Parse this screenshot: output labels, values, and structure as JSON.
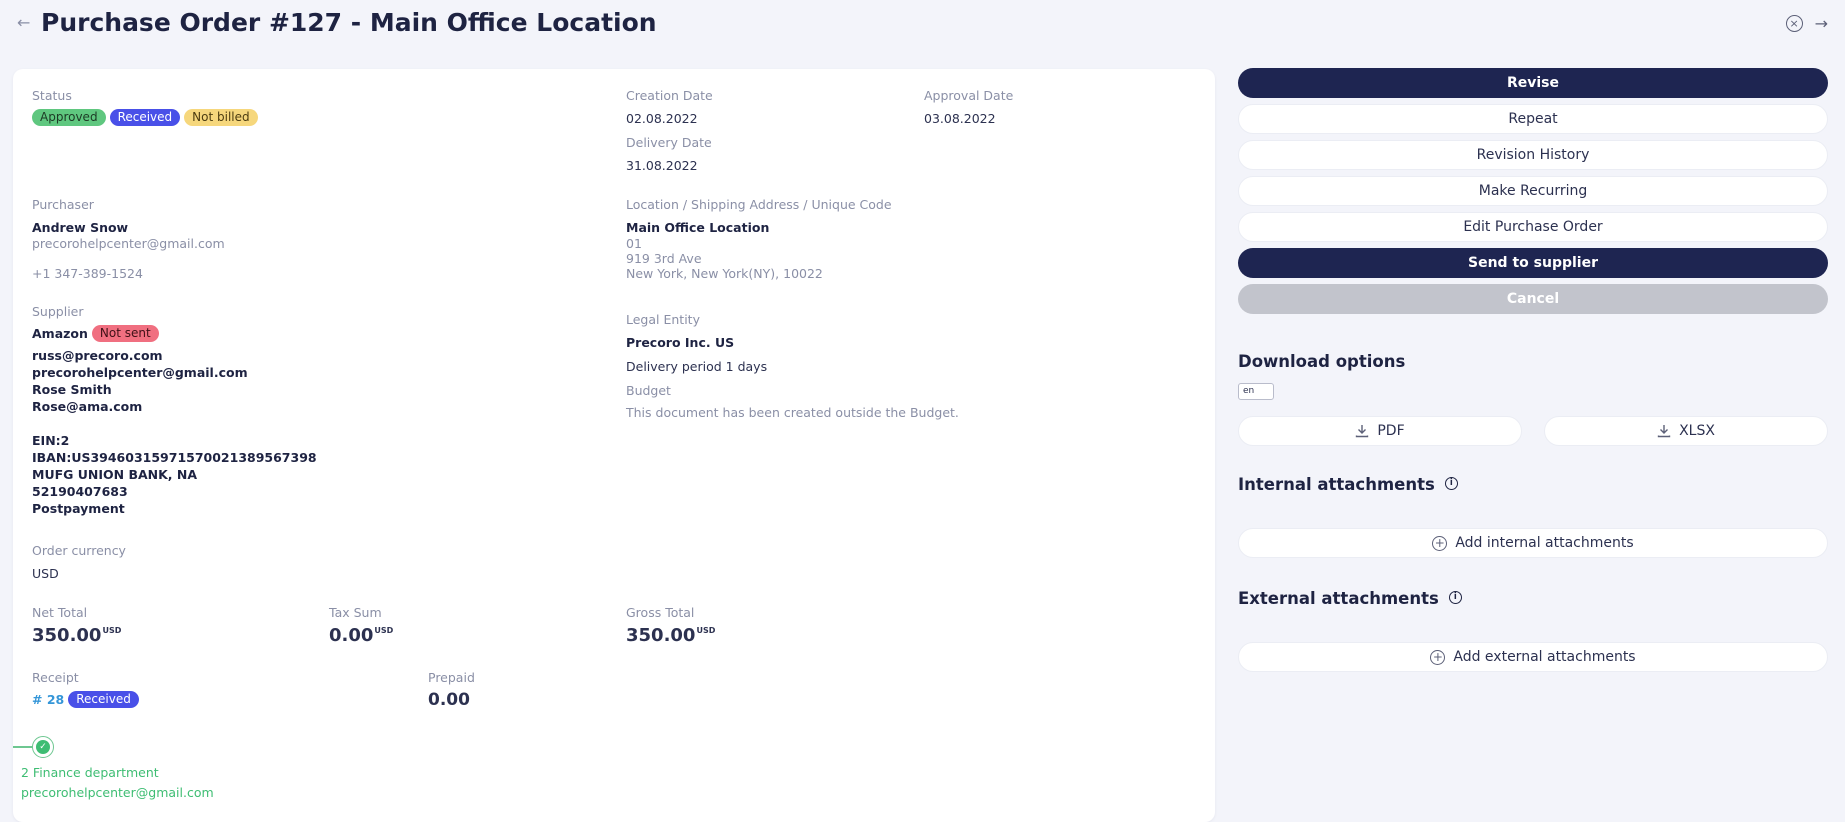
{
  "header": {
    "title": "Purchase Order #127 - Main Office Location",
    "back_icon": "arrow-left-icon",
    "close_icon": "circle-x-icon",
    "forward_icon": "arrow-right-icon"
  },
  "details": {
    "status": {
      "label": "Status",
      "badges": [
        {
          "text": "Approved",
          "color": "#5fc77f"
        },
        {
          "text": "Received",
          "color": "#4950e8"
        },
        {
          "text": "Not billed",
          "color": "#f6d77c"
        }
      ]
    },
    "creation_date": {
      "label": "Creation Date",
      "value": "02.08.2022"
    },
    "approval_date": {
      "label": "Approval Date",
      "value": "03.08.2022"
    },
    "delivery_date": {
      "label": "Delivery Date",
      "value": "31.08.2022"
    },
    "purchaser": {
      "label": "Purchaser",
      "name": "Andrew Snow",
      "email": "precorohelpcenter@gmail.com",
      "phone": "+1 347-389-1524"
    },
    "location": {
      "label": "Location / Shipping Address / Unique Code",
      "name": "Main Office Location",
      "code": "01",
      "street": "919 3rd Ave",
      "city": "New York, New York(NY), 10022"
    },
    "supplier": {
      "label": "Supplier",
      "name": "Amazon",
      "badge": "Not sent",
      "lines": [
        "russ@precoro.com",
        "precorohelpcenter@gmail.com",
        "Rose Smith",
        "Rose@ama.com"
      ],
      "bank_lines": [
        "EIN:2",
        "IBAN:US394603159715700213895673​98",
        "MUFG UNION BANK, NA",
        "52190407683",
        "Postpayment"
      ]
    },
    "legal_entity": {
      "label": "Legal Entity",
      "value": "Precoro Inc. US"
    },
    "delivery_period": "Delivery period 1 days",
    "budget": {
      "label": "Budget",
      "value": "This document has been created outside the Budget."
    },
    "currency": {
      "label": "Order currency",
      "value": "USD"
    },
    "totals": {
      "net": {
        "label": "Net Total",
        "value": "350.00",
        "unit": "USD"
      },
      "tax": {
        "label": "Tax Sum",
        "value": "0.00",
        "unit": "USD"
      },
      "gross": {
        "label": "Gross Total",
        "value": "350.00",
        "unit": "USD"
      }
    },
    "receipt": {
      "label": "Receipt",
      "link": "# 28",
      "badge": "Received"
    },
    "prepaid": {
      "label": "Prepaid",
      "value": "0.00"
    },
    "approval_step": {
      "name": "2 Finance department",
      "email": "precorohelpcenter@gmail.com"
    }
  },
  "actions": {
    "revise": "Revise",
    "repeat": "Repeat",
    "revision_history": "Revision History",
    "make_recurring": "Make Recurring",
    "edit": "Edit Purchase Order",
    "send": "Send to supplier",
    "cancel": "Cancel"
  },
  "download": {
    "heading": "Download options",
    "language": "en",
    "pdf": "PDF",
    "xlsx": "XLSX"
  },
  "attachments": {
    "internal_heading": "Internal attachments",
    "internal_add": "Add internal attachments",
    "external_heading": "External attachments",
    "external_add": "Add external attachments"
  }
}
